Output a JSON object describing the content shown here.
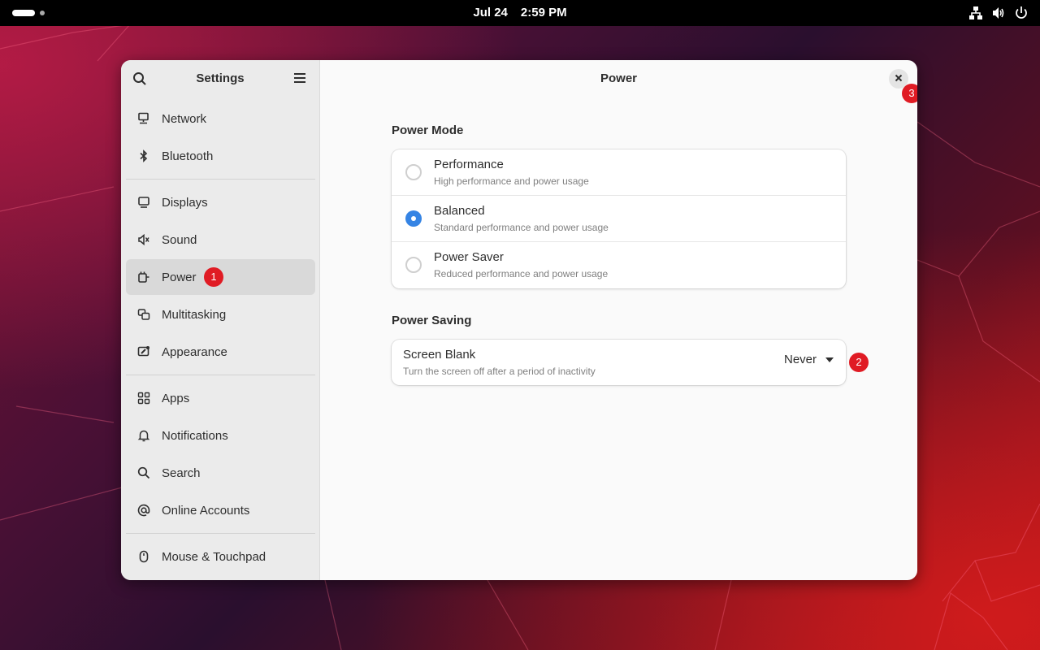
{
  "topbar": {
    "date": "Jul 24",
    "time": "2:59 PM",
    "tray_icons": [
      "network-wired-icon",
      "volume-icon",
      "power-icon"
    ]
  },
  "sidebar": {
    "title": "Settings",
    "items": [
      {
        "label": "Network",
        "icon": "network-icon"
      },
      {
        "label": "Bluetooth",
        "icon": "bluetooth-icon"
      },
      {
        "label": "Displays",
        "icon": "display-icon"
      },
      {
        "label": "Sound",
        "icon": "speaker-icon"
      },
      {
        "label": "Power",
        "icon": "power-plug-icon",
        "active": true
      },
      {
        "label": "Multitasking",
        "icon": "multitasking-icon"
      },
      {
        "label": "Appearance",
        "icon": "appearance-icon"
      },
      {
        "label": "Apps",
        "icon": "apps-grid-icon"
      },
      {
        "label": "Notifications",
        "icon": "bell-icon"
      },
      {
        "label": "Search",
        "icon": "search-icon"
      },
      {
        "label": "Online Accounts",
        "icon": "at-icon"
      },
      {
        "label": "Mouse & Touchpad",
        "icon": "mouse-icon"
      }
    ]
  },
  "badges": {
    "power": "1",
    "screen_blank": "2",
    "close": "3"
  },
  "colors": {
    "accent": "#3584e4",
    "badge": "#e01b24"
  },
  "main": {
    "title": "Power",
    "power_mode": {
      "title": "Power Mode",
      "options": [
        {
          "title": "Performance",
          "subtitle": "High performance and power usage",
          "selected": false
        },
        {
          "title": "Balanced",
          "subtitle": "Standard performance and power usage",
          "selected": true
        },
        {
          "title": "Power Saver",
          "subtitle": "Reduced performance and power usage",
          "selected": false
        }
      ]
    },
    "power_saving": {
      "title": "Power Saving",
      "screen_blank": {
        "title": "Screen Blank",
        "subtitle": "Turn the screen off after a period of inactivity",
        "value": "Never"
      }
    }
  }
}
